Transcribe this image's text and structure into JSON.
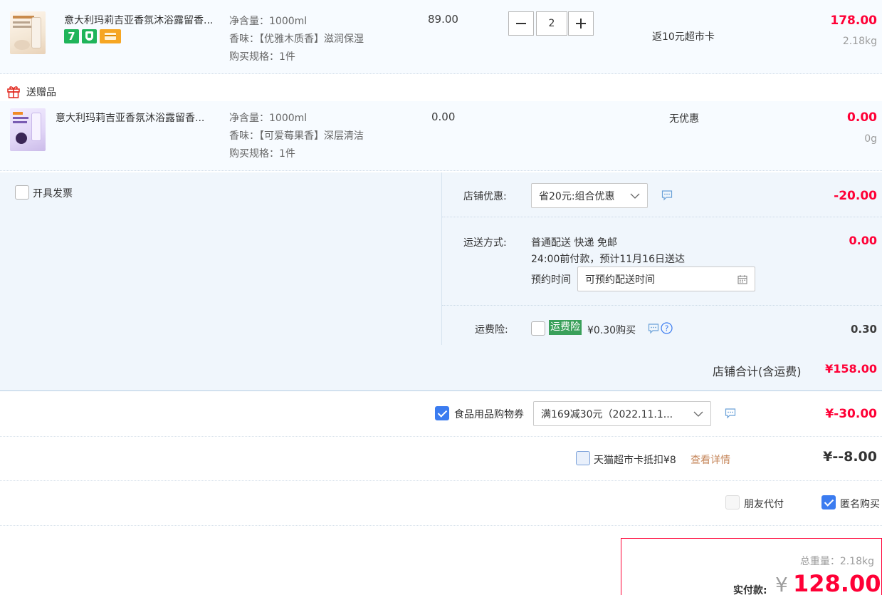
{
  "item1": {
    "title": "意大利玛莉吉亚香氛沐浴露留香...",
    "spec_volume": "净含量：1000ml",
    "spec_scent": "香味：【优雅木质香】滋润保湿",
    "spec_qty": "购买规格：1件",
    "unit_price": "89.00",
    "quantity": "2",
    "promo": "返10元超市卡",
    "subtotal": "178.00",
    "weight": "2.18kg",
    "badge_7": "7"
  },
  "gift": {
    "header": "送赠品",
    "title": "意大利玛莉吉亚香氛沐浴露留香...",
    "spec_volume": "净含量：1000ml",
    "spec_scent": "香味：【可爱莓果香】深层清洁",
    "spec_qty": "购买规格：1件",
    "unit_price": "0.00",
    "promo": "无优惠",
    "subtotal": "0.00",
    "weight": "0g"
  },
  "order": {
    "invoice_label": "开具发票",
    "shop_discount_label": "店铺优惠:",
    "shop_discount_select": "省20元:组合优惠",
    "shop_discount_value": "-20.00",
    "delivery_label": "运送方式:",
    "delivery_method": "普通配送 快递 免邮",
    "delivery_eta": "24:00前付款，预计11月16日送达",
    "schedule_label": "预约时间",
    "schedule_select": "可预约配送时间",
    "delivery_value": "0.00",
    "insurance_label": "运费险:",
    "insurance_tag": "运费险",
    "insurance_desc": "¥0.30购买",
    "insurance_value": "0.30",
    "shop_total_label": "店铺合计(含运费)",
    "shop_total_value": "¥158.00"
  },
  "coupons": {
    "food_coupon_label": "食品用品购物券",
    "food_coupon_select": "满169减30元（2022.11.1...",
    "food_coupon_value": "¥-30.00",
    "tmall_card_label": "天猫超市卡抵扣¥8",
    "tmall_card_link": "查看详情",
    "tmall_card_value": "¥--8.00",
    "friend_pay_label": "朋友代付",
    "anonymous_label": "匿名购买"
  },
  "summary": {
    "weight_label": "总重量：2.18kg",
    "pay_label": "实付款:",
    "currency": "¥",
    "pay_value": "128.00"
  },
  "colors": {
    "accent_red": "#ff0036",
    "link_brown": "#c6875b",
    "checkbox_blue": "#3b7cf0",
    "insurance_green": "#3aa05a",
    "panel_bg": "#f0f6fc"
  }
}
